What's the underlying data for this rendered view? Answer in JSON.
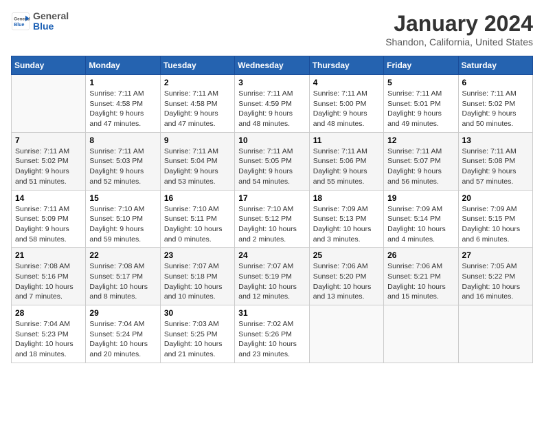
{
  "header": {
    "logo_general": "General",
    "logo_blue": "Blue",
    "month_year": "January 2024",
    "location": "Shandon, California, United States"
  },
  "weekdays": [
    "Sunday",
    "Monday",
    "Tuesday",
    "Wednesday",
    "Thursday",
    "Friday",
    "Saturday"
  ],
  "weeks": [
    [
      {
        "day": "",
        "info": ""
      },
      {
        "day": "1",
        "info": "Sunrise: 7:11 AM\nSunset: 4:58 PM\nDaylight: 9 hours\nand 47 minutes."
      },
      {
        "day": "2",
        "info": "Sunrise: 7:11 AM\nSunset: 4:58 PM\nDaylight: 9 hours\nand 47 minutes."
      },
      {
        "day": "3",
        "info": "Sunrise: 7:11 AM\nSunset: 4:59 PM\nDaylight: 9 hours\nand 48 minutes."
      },
      {
        "day": "4",
        "info": "Sunrise: 7:11 AM\nSunset: 5:00 PM\nDaylight: 9 hours\nand 48 minutes."
      },
      {
        "day": "5",
        "info": "Sunrise: 7:11 AM\nSunset: 5:01 PM\nDaylight: 9 hours\nand 49 minutes."
      },
      {
        "day": "6",
        "info": "Sunrise: 7:11 AM\nSunset: 5:02 PM\nDaylight: 9 hours\nand 50 minutes."
      }
    ],
    [
      {
        "day": "7",
        "info": "Sunrise: 7:11 AM\nSunset: 5:02 PM\nDaylight: 9 hours\nand 51 minutes."
      },
      {
        "day": "8",
        "info": "Sunrise: 7:11 AM\nSunset: 5:03 PM\nDaylight: 9 hours\nand 52 minutes."
      },
      {
        "day": "9",
        "info": "Sunrise: 7:11 AM\nSunset: 5:04 PM\nDaylight: 9 hours\nand 53 minutes."
      },
      {
        "day": "10",
        "info": "Sunrise: 7:11 AM\nSunset: 5:05 PM\nDaylight: 9 hours\nand 54 minutes."
      },
      {
        "day": "11",
        "info": "Sunrise: 7:11 AM\nSunset: 5:06 PM\nDaylight: 9 hours\nand 55 minutes."
      },
      {
        "day": "12",
        "info": "Sunrise: 7:11 AM\nSunset: 5:07 PM\nDaylight: 9 hours\nand 56 minutes."
      },
      {
        "day": "13",
        "info": "Sunrise: 7:11 AM\nSunset: 5:08 PM\nDaylight: 9 hours\nand 57 minutes."
      }
    ],
    [
      {
        "day": "14",
        "info": "Sunrise: 7:11 AM\nSunset: 5:09 PM\nDaylight: 9 hours\nand 58 minutes."
      },
      {
        "day": "15",
        "info": "Sunrise: 7:10 AM\nSunset: 5:10 PM\nDaylight: 9 hours\nand 59 minutes."
      },
      {
        "day": "16",
        "info": "Sunrise: 7:10 AM\nSunset: 5:11 PM\nDaylight: 10 hours\nand 0 minutes."
      },
      {
        "day": "17",
        "info": "Sunrise: 7:10 AM\nSunset: 5:12 PM\nDaylight: 10 hours\nand 2 minutes."
      },
      {
        "day": "18",
        "info": "Sunrise: 7:09 AM\nSunset: 5:13 PM\nDaylight: 10 hours\nand 3 minutes."
      },
      {
        "day": "19",
        "info": "Sunrise: 7:09 AM\nSunset: 5:14 PM\nDaylight: 10 hours\nand 4 minutes."
      },
      {
        "day": "20",
        "info": "Sunrise: 7:09 AM\nSunset: 5:15 PM\nDaylight: 10 hours\nand 6 minutes."
      }
    ],
    [
      {
        "day": "21",
        "info": "Sunrise: 7:08 AM\nSunset: 5:16 PM\nDaylight: 10 hours\nand 7 minutes."
      },
      {
        "day": "22",
        "info": "Sunrise: 7:08 AM\nSunset: 5:17 PM\nDaylight: 10 hours\nand 8 minutes."
      },
      {
        "day": "23",
        "info": "Sunrise: 7:07 AM\nSunset: 5:18 PM\nDaylight: 10 hours\nand 10 minutes."
      },
      {
        "day": "24",
        "info": "Sunrise: 7:07 AM\nSunset: 5:19 PM\nDaylight: 10 hours\nand 12 minutes."
      },
      {
        "day": "25",
        "info": "Sunrise: 7:06 AM\nSunset: 5:20 PM\nDaylight: 10 hours\nand 13 minutes."
      },
      {
        "day": "26",
        "info": "Sunrise: 7:06 AM\nSunset: 5:21 PM\nDaylight: 10 hours\nand 15 minutes."
      },
      {
        "day": "27",
        "info": "Sunrise: 7:05 AM\nSunset: 5:22 PM\nDaylight: 10 hours\nand 16 minutes."
      }
    ],
    [
      {
        "day": "28",
        "info": "Sunrise: 7:04 AM\nSunset: 5:23 PM\nDaylight: 10 hours\nand 18 minutes."
      },
      {
        "day": "29",
        "info": "Sunrise: 7:04 AM\nSunset: 5:24 PM\nDaylight: 10 hours\nand 20 minutes."
      },
      {
        "day": "30",
        "info": "Sunrise: 7:03 AM\nSunset: 5:25 PM\nDaylight: 10 hours\nand 21 minutes."
      },
      {
        "day": "31",
        "info": "Sunrise: 7:02 AM\nSunset: 5:26 PM\nDaylight: 10 hours\nand 23 minutes."
      },
      {
        "day": "",
        "info": ""
      },
      {
        "day": "",
        "info": ""
      },
      {
        "day": "",
        "info": ""
      }
    ]
  ]
}
